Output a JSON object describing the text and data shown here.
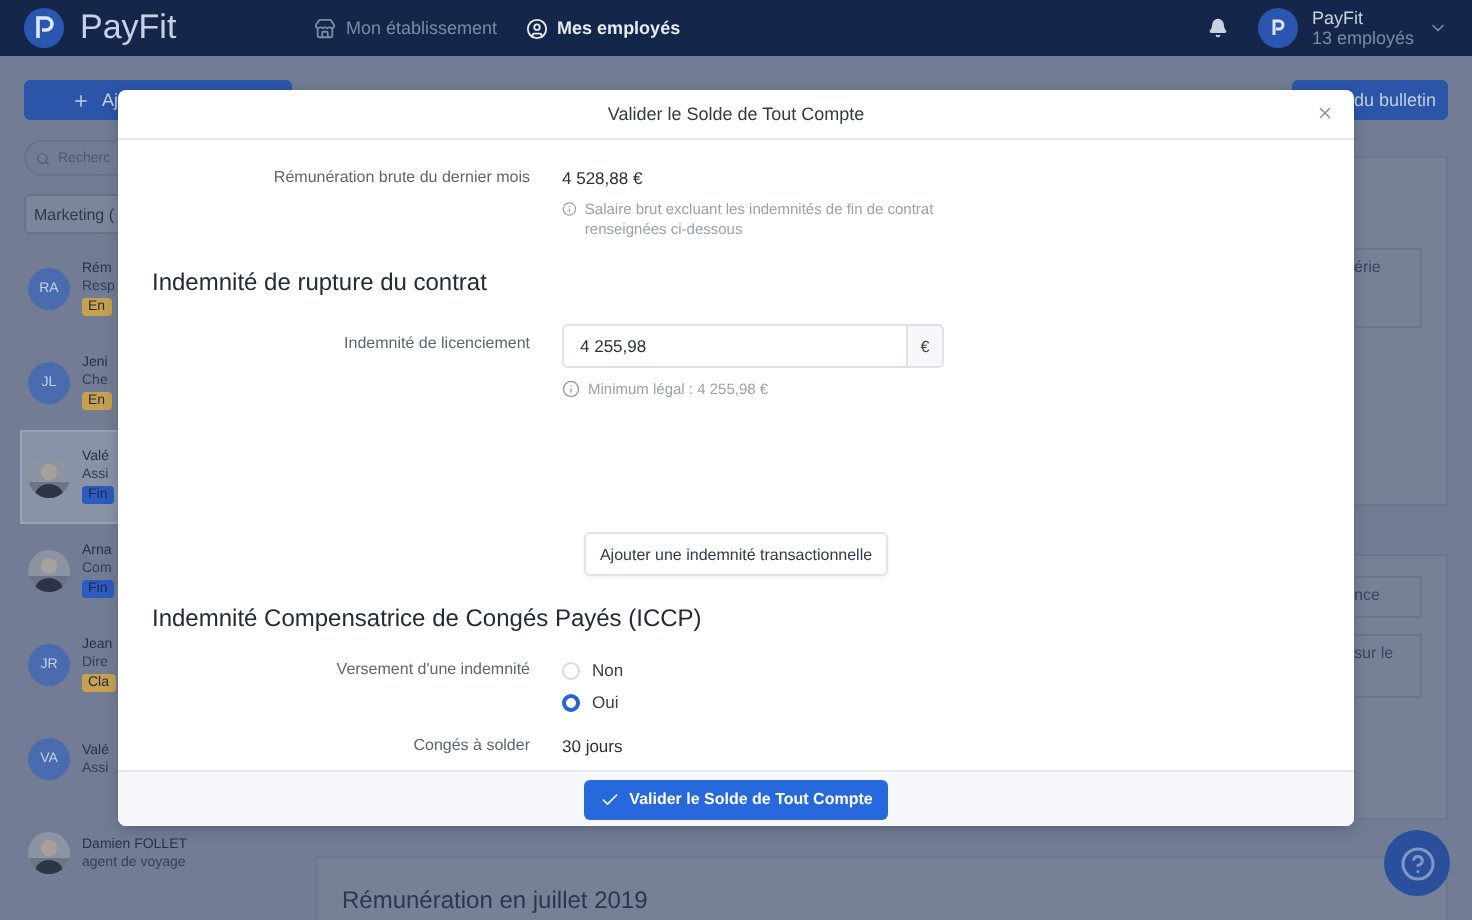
{
  "nav": {
    "logo": "PayFit",
    "links": [
      {
        "label": "Mon établissement",
        "selected": false
      },
      {
        "label": "Mes employés",
        "selected": true
      }
    ],
    "account": {
      "name": "PayFit",
      "subtitle": "13 employés"
    }
  },
  "background": {
    "add_button": "Aj",
    "search": {
      "placeholder": "Recherc"
    },
    "filter": "Marketing (",
    "employees": [
      {
        "name": "Rém",
        "role": "Resp",
        "avatar": "RA",
        "badge": "En",
        "color": "#c7a14e",
        "selected": false
      },
      {
        "name": "Jeni",
        "role": "Che",
        "avatar": "JL",
        "badge": "En",
        "color": "#c7a14e",
        "selected": false
      },
      {
        "name": "Valé",
        "role": "Assi",
        "kind": "picture",
        "badge": "Fin",
        "color": "#2c5cc0",
        "selected": true
      },
      {
        "name": "Arna",
        "role": "Com",
        "kind": "picture",
        "badge": "Fin",
        "color": "#2c5cc0",
        "selected": false
      },
      {
        "name": "Jean",
        "role": "Dire",
        "avatar": "JR",
        "badge": "Cla",
        "color": "#c7a14e",
        "selected": false
      },
      {
        "name": "Valé",
        "role": "Assi",
        "avatar": "VA",
        "selected": false
      },
      {
        "name": "Damien FOLLET",
        "role": "agent de voyage",
        "kind": "picture",
        "selected": false
      }
    ],
    "bulletin_button": "du bulletin",
    "side_cards": [
      {
        "items": [
          "érie"
        ]
      },
      {
        "items": [
          "nce",
          "sur le"
        ]
      }
    ],
    "section_title": "Rémunération en juillet 2019"
  },
  "modal": {
    "title": "Valider le Solde de Tout Compte",
    "sections": [
      {
        "rows": [
          {
            "kind": "value",
            "label": "Rémunération brute du dernier mois",
            "value": "4 528,88 €",
            "hint": "Salaire brut excluant les indemnités de fin de contrat renseignées ci-dessous"
          }
        ]
      },
      {
        "heading": "Indemnité de rupture du contrat",
        "rows": [
          {
            "kind": "input",
            "label": "Indemnité de licenciement",
            "value": "4 255,98",
            "unit": "€",
            "hint": "Minimum légal : 4 255,98 €"
          }
        ],
        "action": "Ajouter une indemnité transactionnelle"
      },
      {
        "heading": "Indemnité Compensatrice de Congés Payés (ICCP)",
        "rows": [
          {
            "kind": "radio",
            "label": "Versement d'une indemnité",
            "options": [
              {
                "label": "Non",
                "selected": false
              },
              {
                "label": "Oui",
                "selected": true
              }
            ]
          },
          {
            "kind": "value",
            "label": "Congés à solder",
            "value": "30 jours"
          }
        ]
      }
    ],
    "submit": "Valider le Solde de Tout Compte"
  }
}
